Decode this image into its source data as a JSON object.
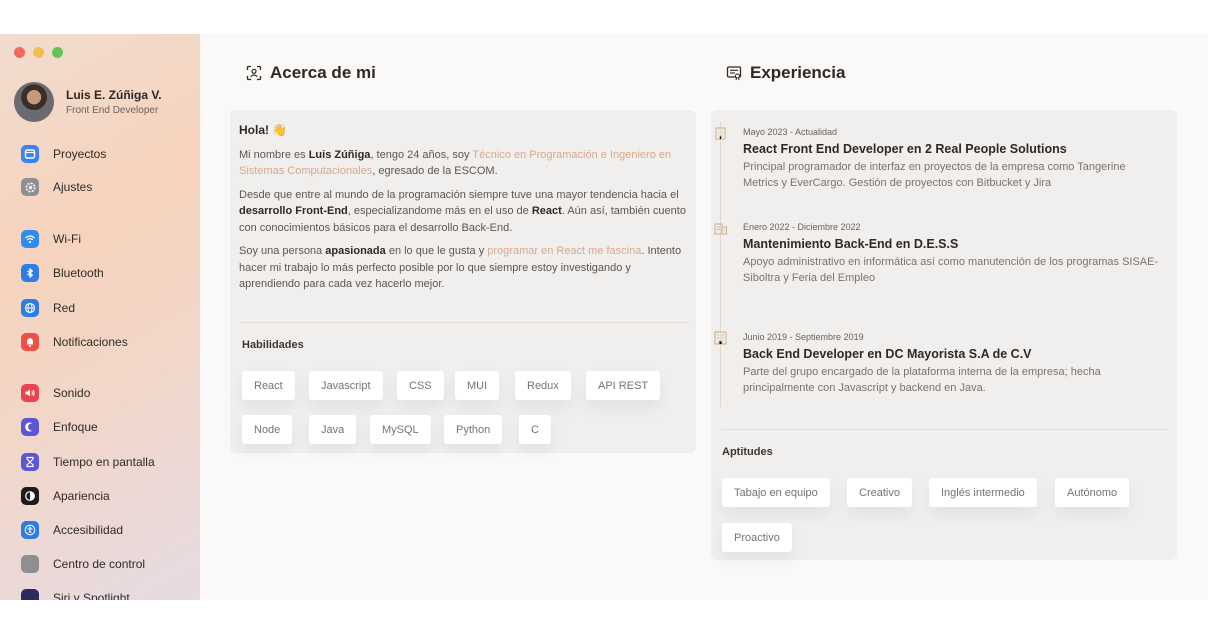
{
  "window": {
    "traffic_lights": [
      "close",
      "minimize",
      "zoom"
    ]
  },
  "sidebar": {
    "profile": {
      "name": "Luis E. Zúñiga V.",
      "role": "Front End Developer"
    },
    "items": [
      {
        "label": "Proyectos",
        "icon": "folder-icon",
        "color": "#3b82f6"
      },
      {
        "label": "Ajustes",
        "icon": "gear-icon",
        "color": "#8e8e93"
      },
      {
        "label": "Wi-Fi",
        "icon": "wifi-icon",
        "color": "#2f8cf3"
      },
      {
        "label": "Bluetooth",
        "icon": "bluetooth-icon",
        "color": "#2f7de3"
      },
      {
        "label": "Red",
        "icon": "globe-icon",
        "color": "#2f7de3"
      },
      {
        "label": "Notificaciones",
        "icon": "bell-icon",
        "color": "#ef4f45"
      },
      {
        "label": "Sonido",
        "icon": "speaker-icon",
        "color": "#e9444f"
      },
      {
        "label": "Enfoque",
        "icon": "moon-icon",
        "color": "#5a56d6"
      },
      {
        "label": "Tiempo en pantalla",
        "icon": "hourglass-icon",
        "color": "#5a56d6"
      },
      {
        "label": "Apariencia",
        "icon": "appearance-icon",
        "color": "#1c1c1e"
      },
      {
        "label": "Accesibilidad",
        "icon": "accessibility-icon",
        "color": "#2f7de3"
      },
      {
        "label": "Centro de control",
        "icon": "control-center-icon",
        "color": "#8e8e93"
      },
      {
        "label": "Siri y Spotlight",
        "icon": "siri-icon",
        "color": "#2b2b5e"
      }
    ]
  },
  "about": {
    "title": "Acerca de mi",
    "greeting": "Hola! 👋",
    "p1": {
      "a": "Mi nombre es ",
      "name": "Luis Zúñiga",
      "b": ", tengo 24 años, soy ",
      "highlight": "Técnico en Programación e Ingeniero en Sistemas Computacionales",
      "c": ", egresado de la ESCOM."
    },
    "p2": {
      "a": "Desde que entre al mundo de la programación siempre tuve una mayor tendencia hacia el ",
      "b1": "desarrollo Front-End",
      "b": ", especializandome más en el uso de ",
      "b2": "React",
      "c": ". Aún así, también cuento con conocimientos básicos para el desarrollo Back-End."
    },
    "p3": {
      "a": "Soy una persona ",
      "b1": "apasionada",
      "b": " en lo que le gusta y ",
      "highlight": "programar en React me fascina",
      "c": ". Intento hacer mi trabajo lo más perfecto posible por lo que siempre estoy investigando y aprendiendo para cada vez hacerlo mejor."
    },
    "skills_title": "Habilidades",
    "skills": [
      "React",
      "Javascript",
      "CSS",
      "MUI",
      "Redux",
      "API REST",
      "Node",
      "Java",
      "MySQL",
      "Python",
      "C"
    ]
  },
  "experience": {
    "title": "Experiencia",
    "jobs": [
      {
        "date": "Mayo 2023 - Actualidad",
        "title": "React Front End Developer en 2 Real People Solutions",
        "desc": "Principal programador de interfaz en proyectos de la empresa como Tangerine Metrics y EverCargo. Gestión de proyectos con Bitbucket y Jira"
      },
      {
        "date": "Enero 2022 - Diciembre 2022",
        "title": "Mantenimiento Back-End en D.E.S.S",
        "desc": "Apoyo administrativo en informática así como manutención de los programas SISAE-Siboltra y Feria del Empleo"
      },
      {
        "date": "Junio 2019 - Septiembre 2019",
        "title": "Back End Developer en DC Mayorista S.A de C.V",
        "desc": "Parte del grupo encargado de la plataforma interna de la empresa; hecha principalmente con Javascript y backend en Java."
      }
    ],
    "aptitudes_title": "Aptitudes",
    "aptitudes": [
      "Tabajo en equipo",
      "Creativo",
      "Inglés intermedio",
      "Autónomo",
      "Proactivo"
    ]
  }
}
